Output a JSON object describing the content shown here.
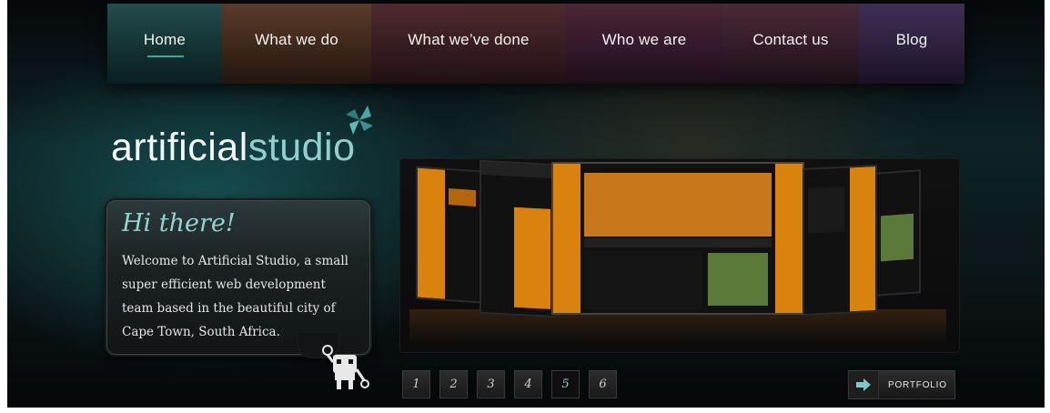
{
  "nav": {
    "items": [
      {
        "label": "Home"
      },
      {
        "label": "What we do"
      },
      {
        "label": "What we’ve done"
      },
      {
        "label": "Who we are"
      },
      {
        "label": "Contact us"
      },
      {
        "label": "Blog"
      }
    ],
    "active_index": 0
  },
  "logo": {
    "part1": "artificial",
    "part2": "studio"
  },
  "welcome": {
    "heading": "Hi there!",
    "body": "Welcome to Artificial Studio, a small super efficient web development team based in the beautiful city of Cape Town, South Africa."
  },
  "pagination": {
    "pages": [
      "1",
      "2",
      "3",
      "4",
      "5",
      "6"
    ],
    "active": "5"
  },
  "portfolio_button": {
    "label": "PORTFOLIO"
  },
  "colors": {
    "accent": "#8ed6d0",
    "orange": "#d9820d"
  },
  "icons": [
    "pinwheel-icon",
    "robot-icon",
    "arrow-right-icon"
  ]
}
